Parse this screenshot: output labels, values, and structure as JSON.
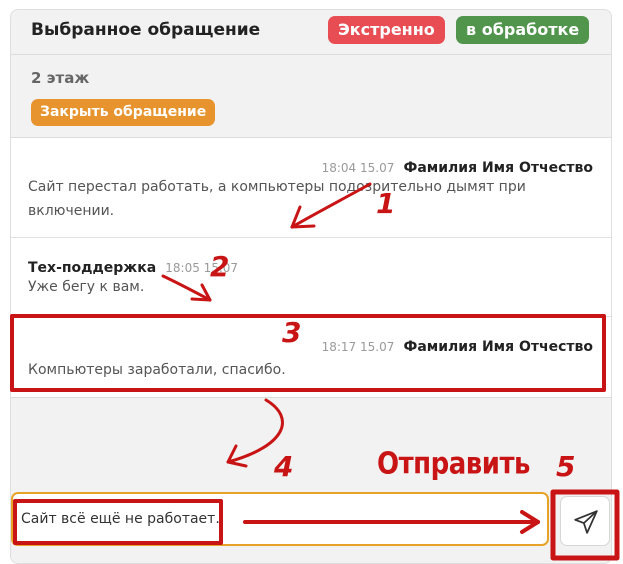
{
  "header": {
    "title": "Выбранное обращение",
    "badge_priority": "Экстренно",
    "badge_status": "в обработке"
  },
  "ticket": {
    "location": "2 этаж",
    "close_label": "Закрыть обращение"
  },
  "messages": [
    {
      "time": "18:04 15.07",
      "author": "Фамилия Имя Отчество",
      "text": "Сайт перестал работать, а компьютеры подозрительно дымят при включении."
    },
    {
      "author": "Тех-поддержка",
      "time": "18:05 15.07",
      "text": "Уже бегу к вам."
    },
    {
      "time": "18:17 15.07",
      "author": "Фамилия Имя Отчество",
      "text": "Компьютеры заработали, спасибо."
    }
  ],
  "composer": {
    "value": "Сайт всё ещё не работает."
  },
  "send_button": {
    "icon": "send-icon"
  },
  "annotations": {
    "send_label": "Отправить",
    "markers": [
      "1",
      "2",
      "3",
      "4",
      "5"
    ],
    "color": "#c81414"
  },
  "colors": {
    "urgent": "#e84d54",
    "in_progress": "#51954d",
    "close_button": "#e8942e",
    "input_border": "#e6a328"
  }
}
